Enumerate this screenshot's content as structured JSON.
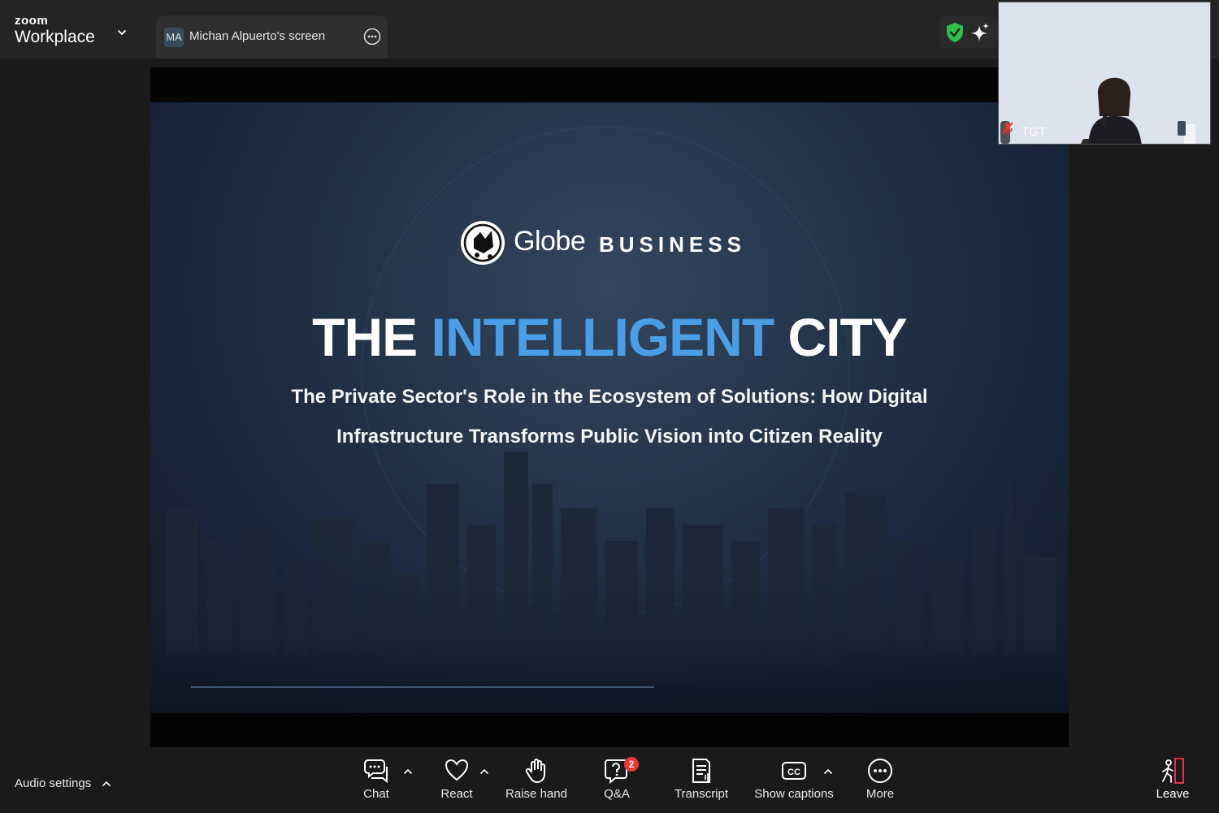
{
  "app": {
    "brand_top": "zoom",
    "brand_bottom": "Workplace"
  },
  "tab": {
    "avatar": "MA",
    "title": "Michan Alpuerto's screen"
  },
  "icons": {
    "shield": "shield-check-icon",
    "sparkle": "ai-companion-icon",
    "more": "more-options-icon"
  },
  "slide": {
    "logo_name": "Globe",
    "logo_business": "BUSINESS",
    "headline_part1": "THE ",
    "headline_part2": "INTELLIGENT",
    "headline_part3": " CITY",
    "subtitle_line1": "The Private Sector's Role in the Ecosystem of Solutions: How Digital",
    "subtitle_line2": "Infrastructure Transforms Public Vision into Citizen Reality"
  },
  "video": {
    "name": "TGT",
    "mic_status": "muted"
  },
  "toolbar": {
    "audio_settings": "Audio settings",
    "chat": "Chat",
    "react": "React",
    "raise_hand": "Raise hand",
    "qa": "Q&A",
    "qa_badge": "2",
    "transcript": "Transcript",
    "show_captions": "Show captions",
    "more": "More",
    "leave": "Leave"
  },
  "colors": {
    "accent_blue": "#4a9ee6",
    "badge_red": "#e53935",
    "shield_green": "#2fbf4f",
    "leave_red": "#e5324a"
  }
}
